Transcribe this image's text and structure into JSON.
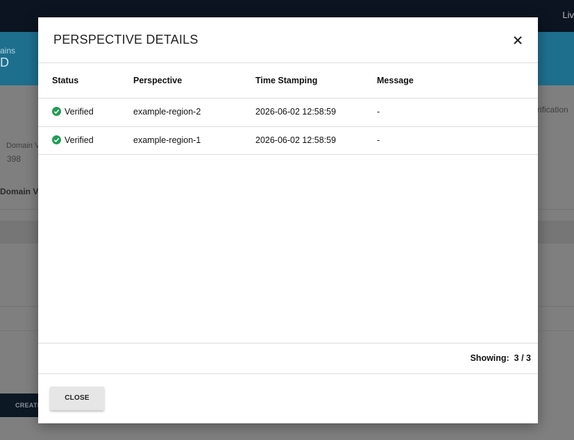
{
  "background": {
    "topbar_right_text": "Liv",
    "banner_subtitle": "ains",
    "banner_value": "D",
    "side_label_right": "rification",
    "field_label": "Domain V",
    "field_value": "398",
    "section_heading": "Domain Ve",
    "create_button_label": "CREATI"
  },
  "modal": {
    "title": "PERSPECTIVE DETAILS",
    "close_icon": "close-icon",
    "columns": [
      "Status",
      "Perspective",
      "Time Stamping",
      "Message"
    ],
    "rows": [
      {
        "status": "Verified",
        "status_icon": "check-circle-icon",
        "perspective": "example-region-2",
        "time": "2026-06-02 12:58:59",
        "message": "-"
      },
      {
        "status": "Verified",
        "status_icon": "check-circle-icon",
        "perspective": "example-region-1",
        "time": "2026-06-02 12:58:59",
        "message": "-"
      }
    ],
    "footer": {
      "showing_label": "Showing:",
      "showing_value": "3 / 3"
    },
    "close_button_label": "CLOSE",
    "status_color": "#1f9d55"
  }
}
